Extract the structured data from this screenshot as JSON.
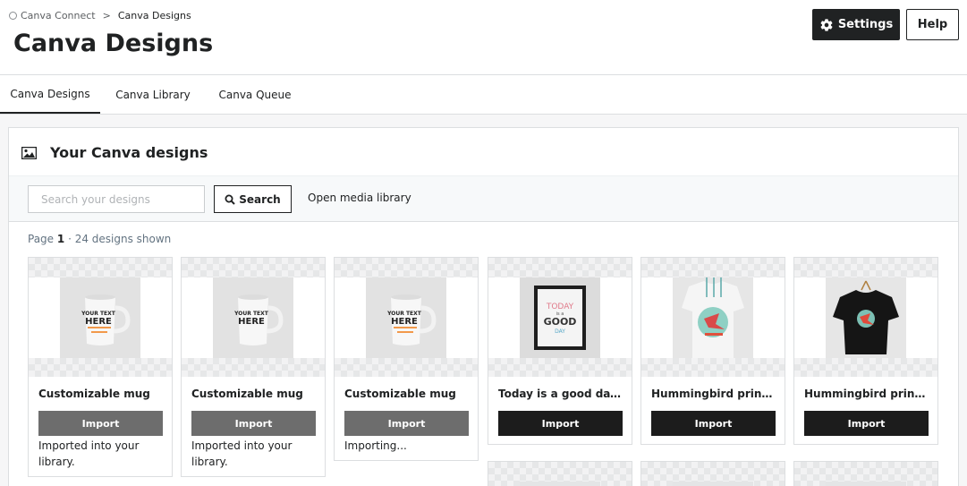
{
  "breadcrumb": {
    "parent": "Canva Connect",
    "separator": ">",
    "current": "Canva Designs"
  },
  "page_title": "Canva Designs",
  "header_buttons": {
    "settings": "Settings",
    "help": "Help"
  },
  "tabs": [
    {
      "label": "Canva Designs",
      "active": true
    },
    {
      "label": "Canva Library",
      "active": false
    },
    {
      "label": "Canva Queue",
      "active": false
    }
  ],
  "section": {
    "title": "Your Canva designs",
    "icon": "image-icon"
  },
  "search": {
    "placeholder": "Search your designs",
    "value": "",
    "button_label": "Search",
    "media_link": "Open media library"
  },
  "pagination": {
    "prefix": "Page",
    "page": "1",
    "suffix": "· 24 designs shown"
  },
  "designs": [
    {
      "title": "Customizable mug",
      "import_label": "Import",
      "status": "Imported into your library.",
      "state": "imported",
      "thumb": "mug"
    },
    {
      "title": "Customizable mug",
      "import_label": "Import",
      "status": "Imported into your library.",
      "state": "imported",
      "thumb": "mug-plain"
    },
    {
      "title": "Customizable mug",
      "import_label": "Import",
      "status": "Importing...",
      "state": "importing",
      "thumb": "mug"
    },
    {
      "title": "Today is a good day F...",
      "import_label": "Import",
      "status": "",
      "state": "ready",
      "thumb": "poster"
    },
    {
      "title": "Hummingbird printed...",
      "import_label": "Import",
      "status": "",
      "state": "ready",
      "thumb": "white-tshirt"
    },
    {
      "title": "Hummingbird printed...",
      "import_label": "Import",
      "status": "",
      "state": "ready",
      "thumb": "black-tshirt"
    }
  ],
  "thumb_text": {
    "mug_line1": "YOUR TEXT",
    "mug_line2": "HERE",
    "poster_line1": "TODAY",
    "poster_line2": "is a",
    "poster_line3": "GOOD",
    "poster_line4": "DAY"
  },
  "colors": {
    "primary_button": "#202223",
    "imported_button": "#6d6d6d",
    "ready_button": "#1c1c1c",
    "muted_text": "#637381"
  }
}
